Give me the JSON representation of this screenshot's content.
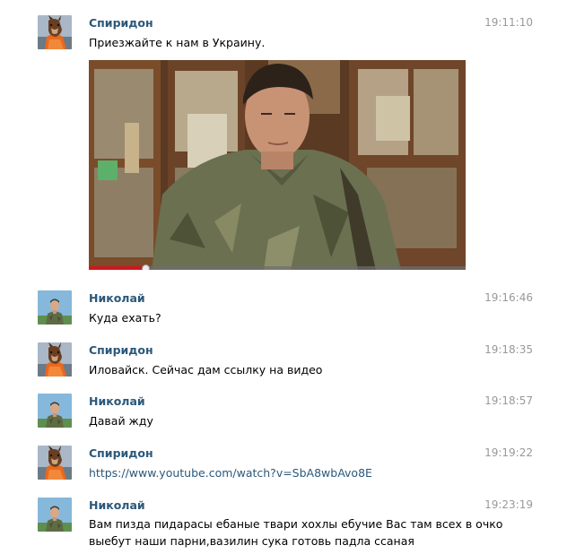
{
  "messages": [
    {
      "author": "Спиридон",
      "avatar_icon": "horse-mask-avatar-icon",
      "time": "19:11:10",
      "text": "Приезжайте к нам в Украину.",
      "video": {
        "playback_progress": 0.15,
        "thumbnail_icon": "video-thumbnail-soldier"
      }
    },
    {
      "author": "Николай",
      "avatar_icon": "soldier-avatar-icon",
      "time": "19:16:46",
      "text": "Куда ехать?"
    },
    {
      "author": "Спиридон",
      "avatar_icon": "horse-mask-avatar-icon",
      "time": "19:18:35",
      "text": "Иловайск. Сейчас дам ссылку на видео"
    },
    {
      "author": "Николай",
      "avatar_icon": "soldier-avatar-icon",
      "time": "19:18:57",
      "text": "Давай жду"
    },
    {
      "author": "Спиридон",
      "avatar_icon": "horse-mask-avatar-icon",
      "time": "19:19:22",
      "link": "https://www.youtube.com/watch?v=SbA8wbAvo8E"
    },
    {
      "author": "Николай",
      "avatar_icon": "soldier-avatar-icon",
      "time": "19:23:19",
      "text_lines": [
        "Вам пизда пидарасы ебаные твари хохлы ебучие Вас там всех в очко",
        "выебут наши парни,вазилин сука готовь падла ссаная"
      ]
    }
  ],
  "colors": {
    "author": "#2b587a",
    "time": "#999999",
    "link": "#2b587a",
    "progress": "#cc181e"
  }
}
